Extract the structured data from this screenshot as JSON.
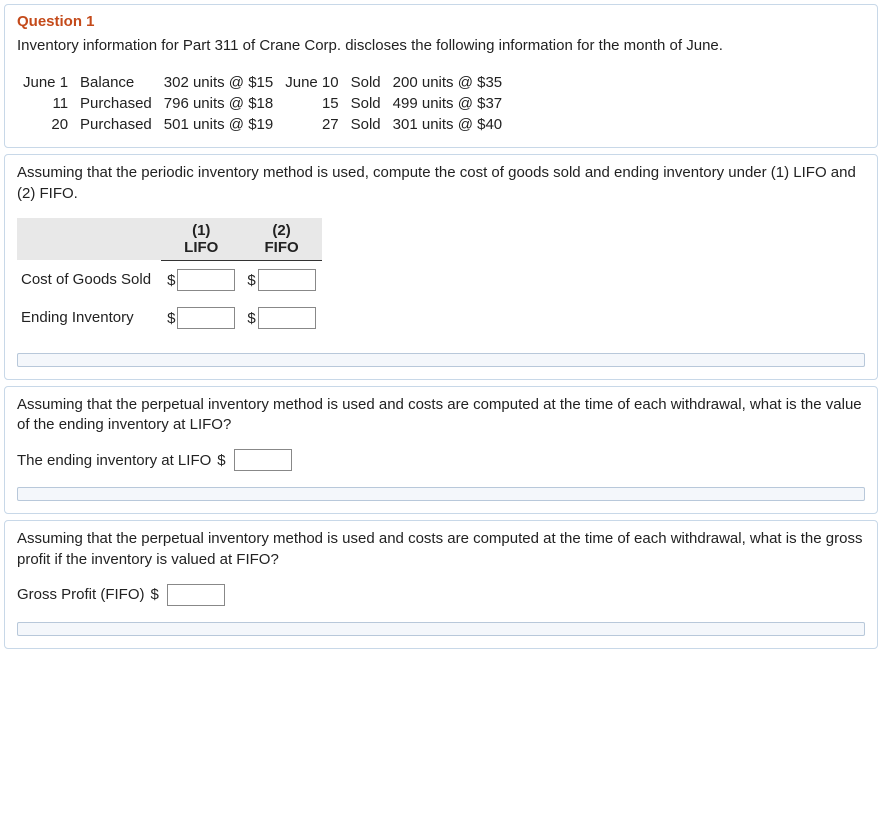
{
  "question": {
    "title": "Question 1",
    "intro": "Inventory information for Part 311 of Crane Corp. discloses the following information for the month of June."
  },
  "inventory": {
    "left": [
      {
        "date": "June 1",
        "action": "Balance",
        "detail": "302 units @ $15"
      },
      {
        "date": "11",
        "action": "Purchased",
        "detail": "796 units @ $18"
      },
      {
        "date": "20",
        "action": "Purchased",
        "detail": "501 units @ $19"
      }
    ],
    "right": [
      {
        "date": "June 10",
        "action": "Sold",
        "detail": "200 units @ $35"
      },
      {
        "date": "15",
        "action": "Sold",
        "detail": "499 units @ $37"
      },
      {
        "date": "27",
        "action": "Sold",
        "detail": "301 units @ $40"
      }
    ]
  },
  "part1": {
    "prompt": "Assuming that the periodic inventory method is used, compute the cost of goods sold and ending inventory under (1) LIFO and (2) FIFO.",
    "col1_num": "(1)",
    "col1_lbl": "LIFO",
    "col2_num": "(2)",
    "col2_lbl": "FIFO",
    "row1": "Cost of Goods Sold",
    "row2": "Ending Inventory",
    "currency": "$"
  },
  "part2": {
    "prompt": "Assuming that the perpetual inventory method is used and costs are computed at the time of each withdrawal, what is the value of the ending inventory at LIFO?",
    "label": "The ending inventory at LIFO",
    "currency": "$"
  },
  "part3": {
    "prompt": "Assuming that the perpetual inventory method is used and costs are computed at the time of each withdrawal, what is the gross profit if the inventory is valued at FIFO?",
    "label": "Gross Profit (FIFO)",
    "currency": "$"
  }
}
